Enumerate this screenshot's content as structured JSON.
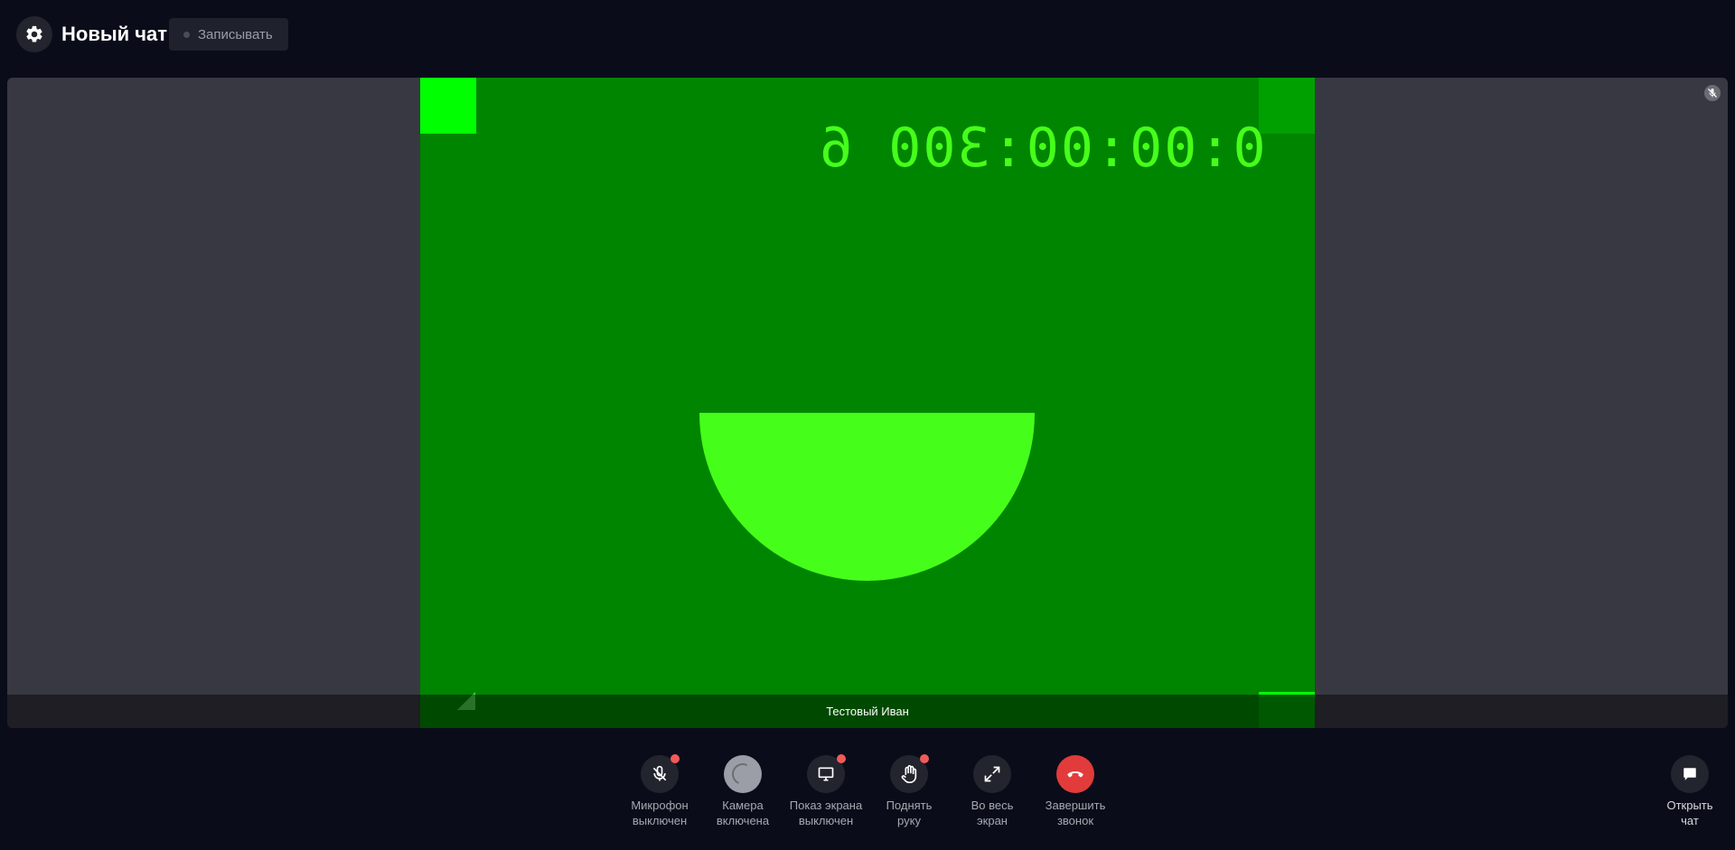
{
  "header": {
    "title": "Новый чат",
    "record_label": "Записывать",
    "settings_icon": "gear-icon"
  },
  "video": {
    "timecode": "0:00:00:300 6",
    "participant_name": "Тестовый Иван",
    "mute_icon": "microphone-muted-icon",
    "colors": {
      "background": "#008500",
      "accent": "#45ff1a",
      "corner": "#00ff00"
    }
  },
  "controls": {
    "mic": {
      "label": "Микрофон\nвыключен",
      "icon": "microphone-off-icon"
    },
    "camera": {
      "label": "Камера\nвключена",
      "icon": "spinner-icon"
    },
    "screen": {
      "label": "Показ экрана\nвыключен",
      "icon": "monitor-icon"
    },
    "hand": {
      "label": "Поднять\nруку",
      "icon": "hand-icon"
    },
    "fullscreen": {
      "label": "Во весь\nэкран",
      "icon": "expand-icon"
    },
    "end_call": {
      "label": "Завершить\nзвонок",
      "icon": "phone-hangup-icon",
      "color": "#e23b3b"
    },
    "open_chat": {
      "label": "Открыть\nчат",
      "icon": "chat-bubble-icon"
    }
  }
}
